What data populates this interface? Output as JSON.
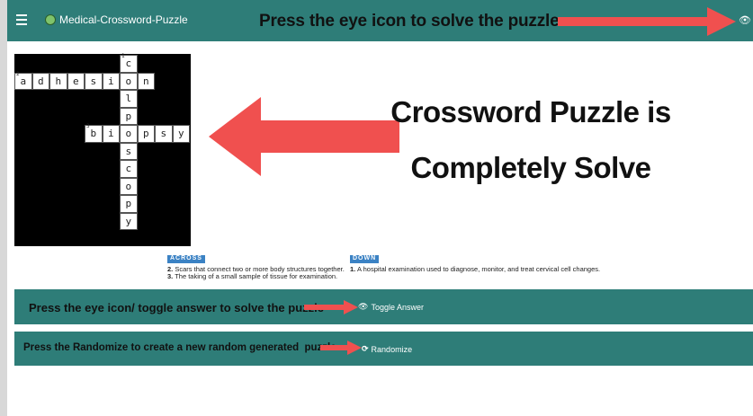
{
  "header": {
    "title": "Medical-Crossword-Puzzle",
    "annotation": "Press the eye icon to solve the puzzle",
    "eye_glyph": "👁"
  },
  "main_annotation": {
    "line1": "Crossword Puzzle is",
    "line2": "Completely Solve"
  },
  "grid": {
    "cells": [
      {
        "r": 0,
        "c": 6,
        "ch": "c",
        "num": "1"
      },
      {
        "r": 1,
        "c": 0,
        "ch": "a",
        "num": "2"
      },
      {
        "r": 1,
        "c": 1,
        "ch": "d"
      },
      {
        "r": 1,
        "c": 2,
        "ch": "h"
      },
      {
        "r": 1,
        "c": 3,
        "ch": "e"
      },
      {
        "r": 1,
        "c": 4,
        "ch": "s"
      },
      {
        "r": 1,
        "c": 5,
        "ch": "i"
      },
      {
        "r": 1,
        "c": 6,
        "ch": "o"
      },
      {
        "r": 1,
        "c": 7,
        "ch": "n"
      },
      {
        "r": 2,
        "c": 6,
        "ch": "l"
      },
      {
        "r": 3,
        "c": 6,
        "ch": "p"
      },
      {
        "r": 4,
        "c": 4,
        "ch": "b",
        "num": "3"
      },
      {
        "r": 4,
        "c": 5,
        "ch": "i"
      },
      {
        "r": 4,
        "c": 6,
        "ch": "o"
      },
      {
        "r": 4,
        "c": 7,
        "ch": "p"
      },
      {
        "r": 4,
        "c": 8,
        "ch": "s"
      },
      {
        "r": 4,
        "c": 9,
        "ch": "y"
      },
      {
        "r": 5,
        "c": 6,
        "ch": "s"
      },
      {
        "r": 6,
        "c": 6,
        "ch": "c"
      },
      {
        "r": 7,
        "c": 6,
        "ch": "o"
      },
      {
        "r": 8,
        "c": 6,
        "ch": "p"
      },
      {
        "r": 9,
        "c": 6,
        "ch": "y"
      }
    ]
  },
  "clues": {
    "across_heading": "ACROSS",
    "across": [
      {
        "num": "2.",
        "text": "Scars that connect two or more body structures together."
      },
      {
        "num": "3.",
        "text": "The taking of a small sample of tissue for examination."
      }
    ],
    "down_heading": "DOWN",
    "down": [
      {
        "num": "1.",
        "text": "A hospital examination used to diagnose, monitor, and treat cervical cell changes."
      }
    ]
  },
  "toggle_bar": {
    "annotation": "Press the eye icon/ toggle answer to solve the puzzle",
    "button_icon": "👁",
    "button_label": "Toggle Answer"
  },
  "randomize_bar": {
    "annotation": "Press the Randomize to create a new random generated  puzzle",
    "button_icon": "⟳",
    "button_label": "Randomize"
  },
  "colors": {
    "teal": "#2e7d78",
    "arrow_red": "#f0504f",
    "clue_heading_blue": "#3b82c4"
  }
}
